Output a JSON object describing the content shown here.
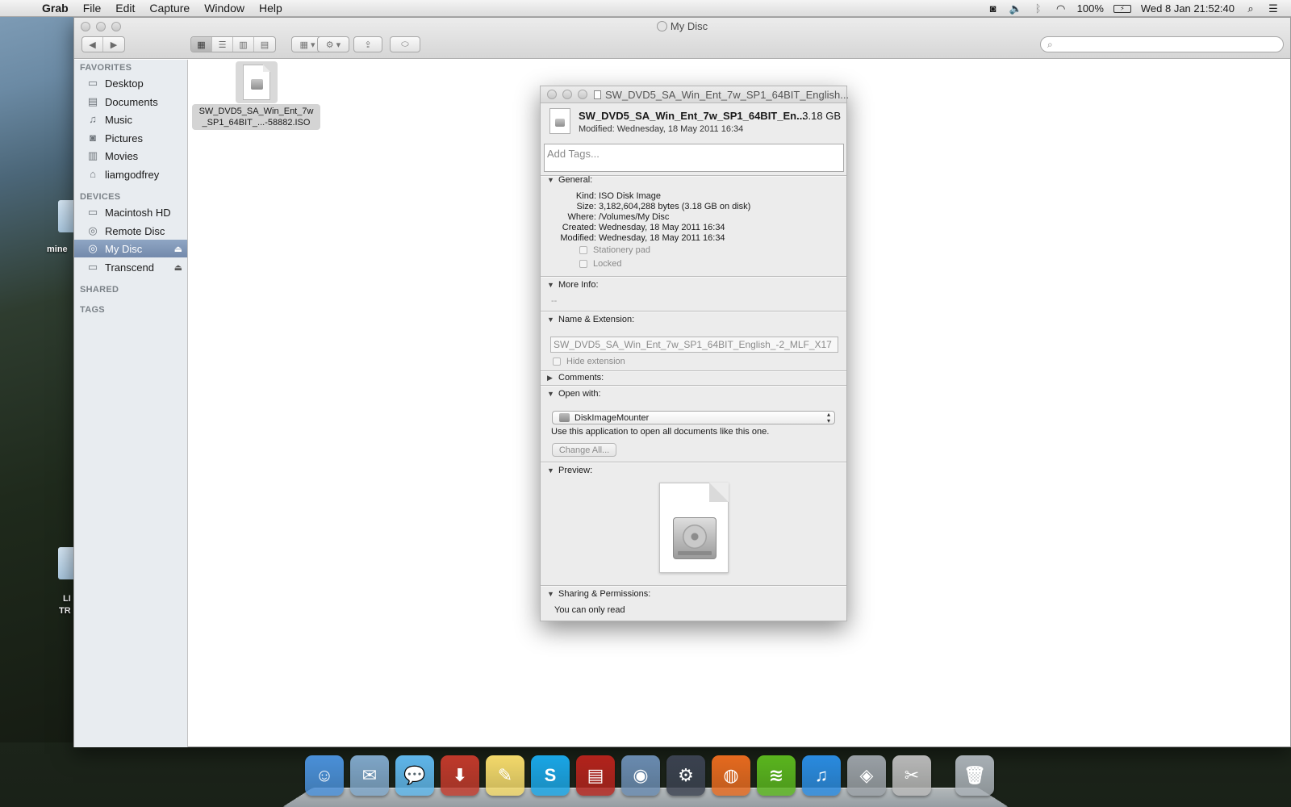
{
  "menubar": {
    "app_name": "Grab",
    "menus": [
      "File",
      "Edit",
      "Capture",
      "Window",
      "Help"
    ],
    "battery": "100%",
    "datetime": "Wed 8 Jan  21:52:40"
  },
  "desktop": {
    "icon1_label": "mine",
    "icon2_label_line1": "LI",
    "icon2_label_line2": "TR"
  },
  "finder": {
    "title": "My Disc",
    "search_placeholder": "",
    "sidebar": {
      "favorites_header": "FAVORITES",
      "favorites": [
        {
          "label": "Desktop",
          "icon": "desktop-icon"
        },
        {
          "label": "Documents",
          "icon": "documents-icon"
        },
        {
          "label": "Music",
          "icon": "music-icon"
        },
        {
          "label": "Pictures",
          "icon": "pictures-icon"
        },
        {
          "label": "Movies",
          "icon": "movies-icon"
        },
        {
          "label": "liamgodfrey",
          "icon": "home-icon"
        }
      ],
      "devices_header": "DEVICES",
      "devices": [
        {
          "label": "Macintosh HD",
          "icon": "hard-drive-icon"
        },
        {
          "label": "Remote Disc",
          "icon": "remote-disc-icon"
        },
        {
          "label": "My Disc",
          "icon": "disc-icon",
          "selected": true
        },
        {
          "label": "Transcend",
          "icon": "external-drive-icon"
        }
      ],
      "shared_header": "SHARED",
      "tags_header": "TAGS"
    },
    "file": {
      "label_line1": "SW_DVD5_SA_Win_Ent_7w",
      "label_line2": "_SP1_64BIT_...-58882.ISO"
    }
  },
  "info": {
    "title": "SW_DVD5_SA_Win_Ent_7w_SP1_64BIT_English...",
    "name": "SW_DVD5_SA_Win_Ent_7w_SP1_64BIT_En...",
    "size": "3.18 GB",
    "modified_header": "Modified: Wednesday, 18 May 2011 16:34",
    "tags_placeholder": "Add Tags...",
    "general": {
      "header": "General:",
      "kind_label": "Kind:",
      "kind": "ISO Disk Image",
      "size_label": "Size:",
      "size": "3,182,604,288 bytes (3.18 GB on disk)",
      "where_label": "Where:",
      "where": "/Volumes/My Disc",
      "created_label": "Created:",
      "created": "Wednesday, 18 May 2011 16:34",
      "modified_label": "Modified:",
      "modified": "Wednesday, 18 May 2011 16:34",
      "stationery": "Stationery pad",
      "locked": "Locked"
    },
    "more_info": {
      "header": "More Info:",
      "value": "--"
    },
    "name_ext": {
      "header": "Name & Extension:",
      "value": "SW_DVD5_SA_Win_Ent_7w_SP1_64BIT_English_-2_MLF_X17",
      "hide_extension": "Hide extension"
    },
    "comments": {
      "header": "Comments:"
    },
    "open_with": {
      "header": "Open with:",
      "app": "DiskImageMounter",
      "note": "Use this application to open all documents like this one.",
      "change_all": "Change All..."
    },
    "preview": {
      "header": "Preview:"
    },
    "sharing": {
      "header": "Sharing & Permissions:",
      "value": "You can only read"
    }
  },
  "dock": {
    "apps": [
      {
        "name": "finder",
        "color": "#4a90d9",
        "glyph": "☺"
      },
      {
        "name": "mail",
        "color": "#7fa6c8",
        "glyph": "✉"
      },
      {
        "name": "messages",
        "color": "#5fb6ea",
        "glyph": "💬"
      },
      {
        "name": "downloader",
        "color": "#c0392b",
        "glyph": "⬇"
      },
      {
        "name": "stickies",
        "color": "#f3d96b",
        "glyph": "✎"
      },
      {
        "name": "skype",
        "color": "#1aa6e6",
        "glyph": "S"
      },
      {
        "name": "photo-booth",
        "color": "#b3231c",
        "glyph": "▤"
      },
      {
        "name": "iphoto",
        "color": "#6a8bb0",
        "glyph": "◉"
      },
      {
        "name": "steam",
        "color": "#3b4250",
        "glyph": "⚙"
      },
      {
        "name": "firefox",
        "color": "#e66a1f",
        "glyph": "◍"
      },
      {
        "name": "spotify",
        "color": "#5ab51e",
        "glyph": "≋"
      },
      {
        "name": "itunes",
        "color": "#2a8be0",
        "glyph": "♫"
      },
      {
        "name": "boot-camp",
        "color": "#9aa0a6",
        "glyph": "◈"
      },
      {
        "name": "utilities",
        "color": "#b8b8b8",
        "glyph": "✂"
      },
      {
        "name": "trash",
        "color": "#a9b0b6",
        "glyph": "🗑"
      }
    ]
  }
}
